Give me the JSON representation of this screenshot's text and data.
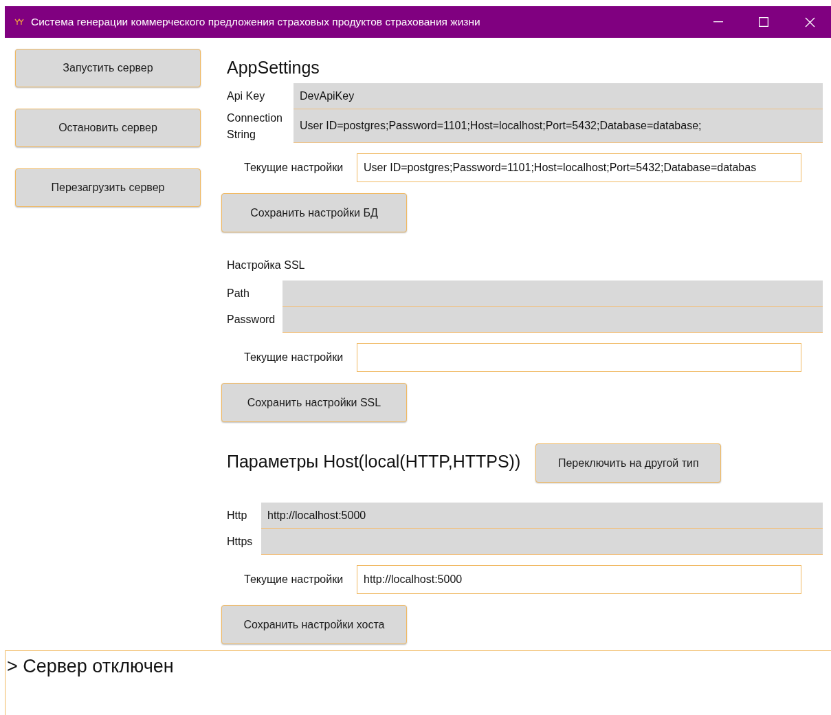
{
  "window": {
    "title": "Система генерации коммерческого предложения страховых продуктов страхования жизни"
  },
  "server_buttons": [
    "Запустить сервер",
    "Остановить сервер",
    "Перезагрузить сервер"
  ],
  "sections": [
    {
      "title": {
        "kind": "heading",
        "text": "AppSettings"
      },
      "fields": [
        {
          "label": "Api Key",
          "value": "DevApiKey"
        },
        {
          "label": "Connection String",
          "value": "User ID=postgres;Password=1101;Host=localhost;Port=5432;Database=database;"
        }
      ],
      "current": {
        "label": "Текущие настройки",
        "value": "User ID=postgres;Password=1101;Host=localhost;Port=5432;Database=databas"
      },
      "save_button": "Сохранить настройки БД"
    },
    {
      "title": {
        "kind": "caption",
        "text": "Настройка SSL"
      },
      "fields": [
        {
          "label": "Path"
        },
        {
          "label": "Password"
        }
      ],
      "current": {
        "label": "Текущие настройки"
      },
      "save_button": "Сохранить настройки SSL"
    },
    {
      "title": {
        "kind": "heading",
        "text": "Параметры Host(local(HTTP,HTTPS))"
      },
      "switch_button": "Переключить на другой тип",
      "fields": [
        {
          "label": "Http",
          "value": "http://localhost:5000"
        },
        {
          "label": "Https"
        }
      ],
      "current": {
        "label": "Текущие настройки",
        "value": "http://localhost:5000"
      },
      "save_button": "Сохранить настройки хоста"
    }
  ],
  "log": [
    "> Сервер отключен"
  ]
}
